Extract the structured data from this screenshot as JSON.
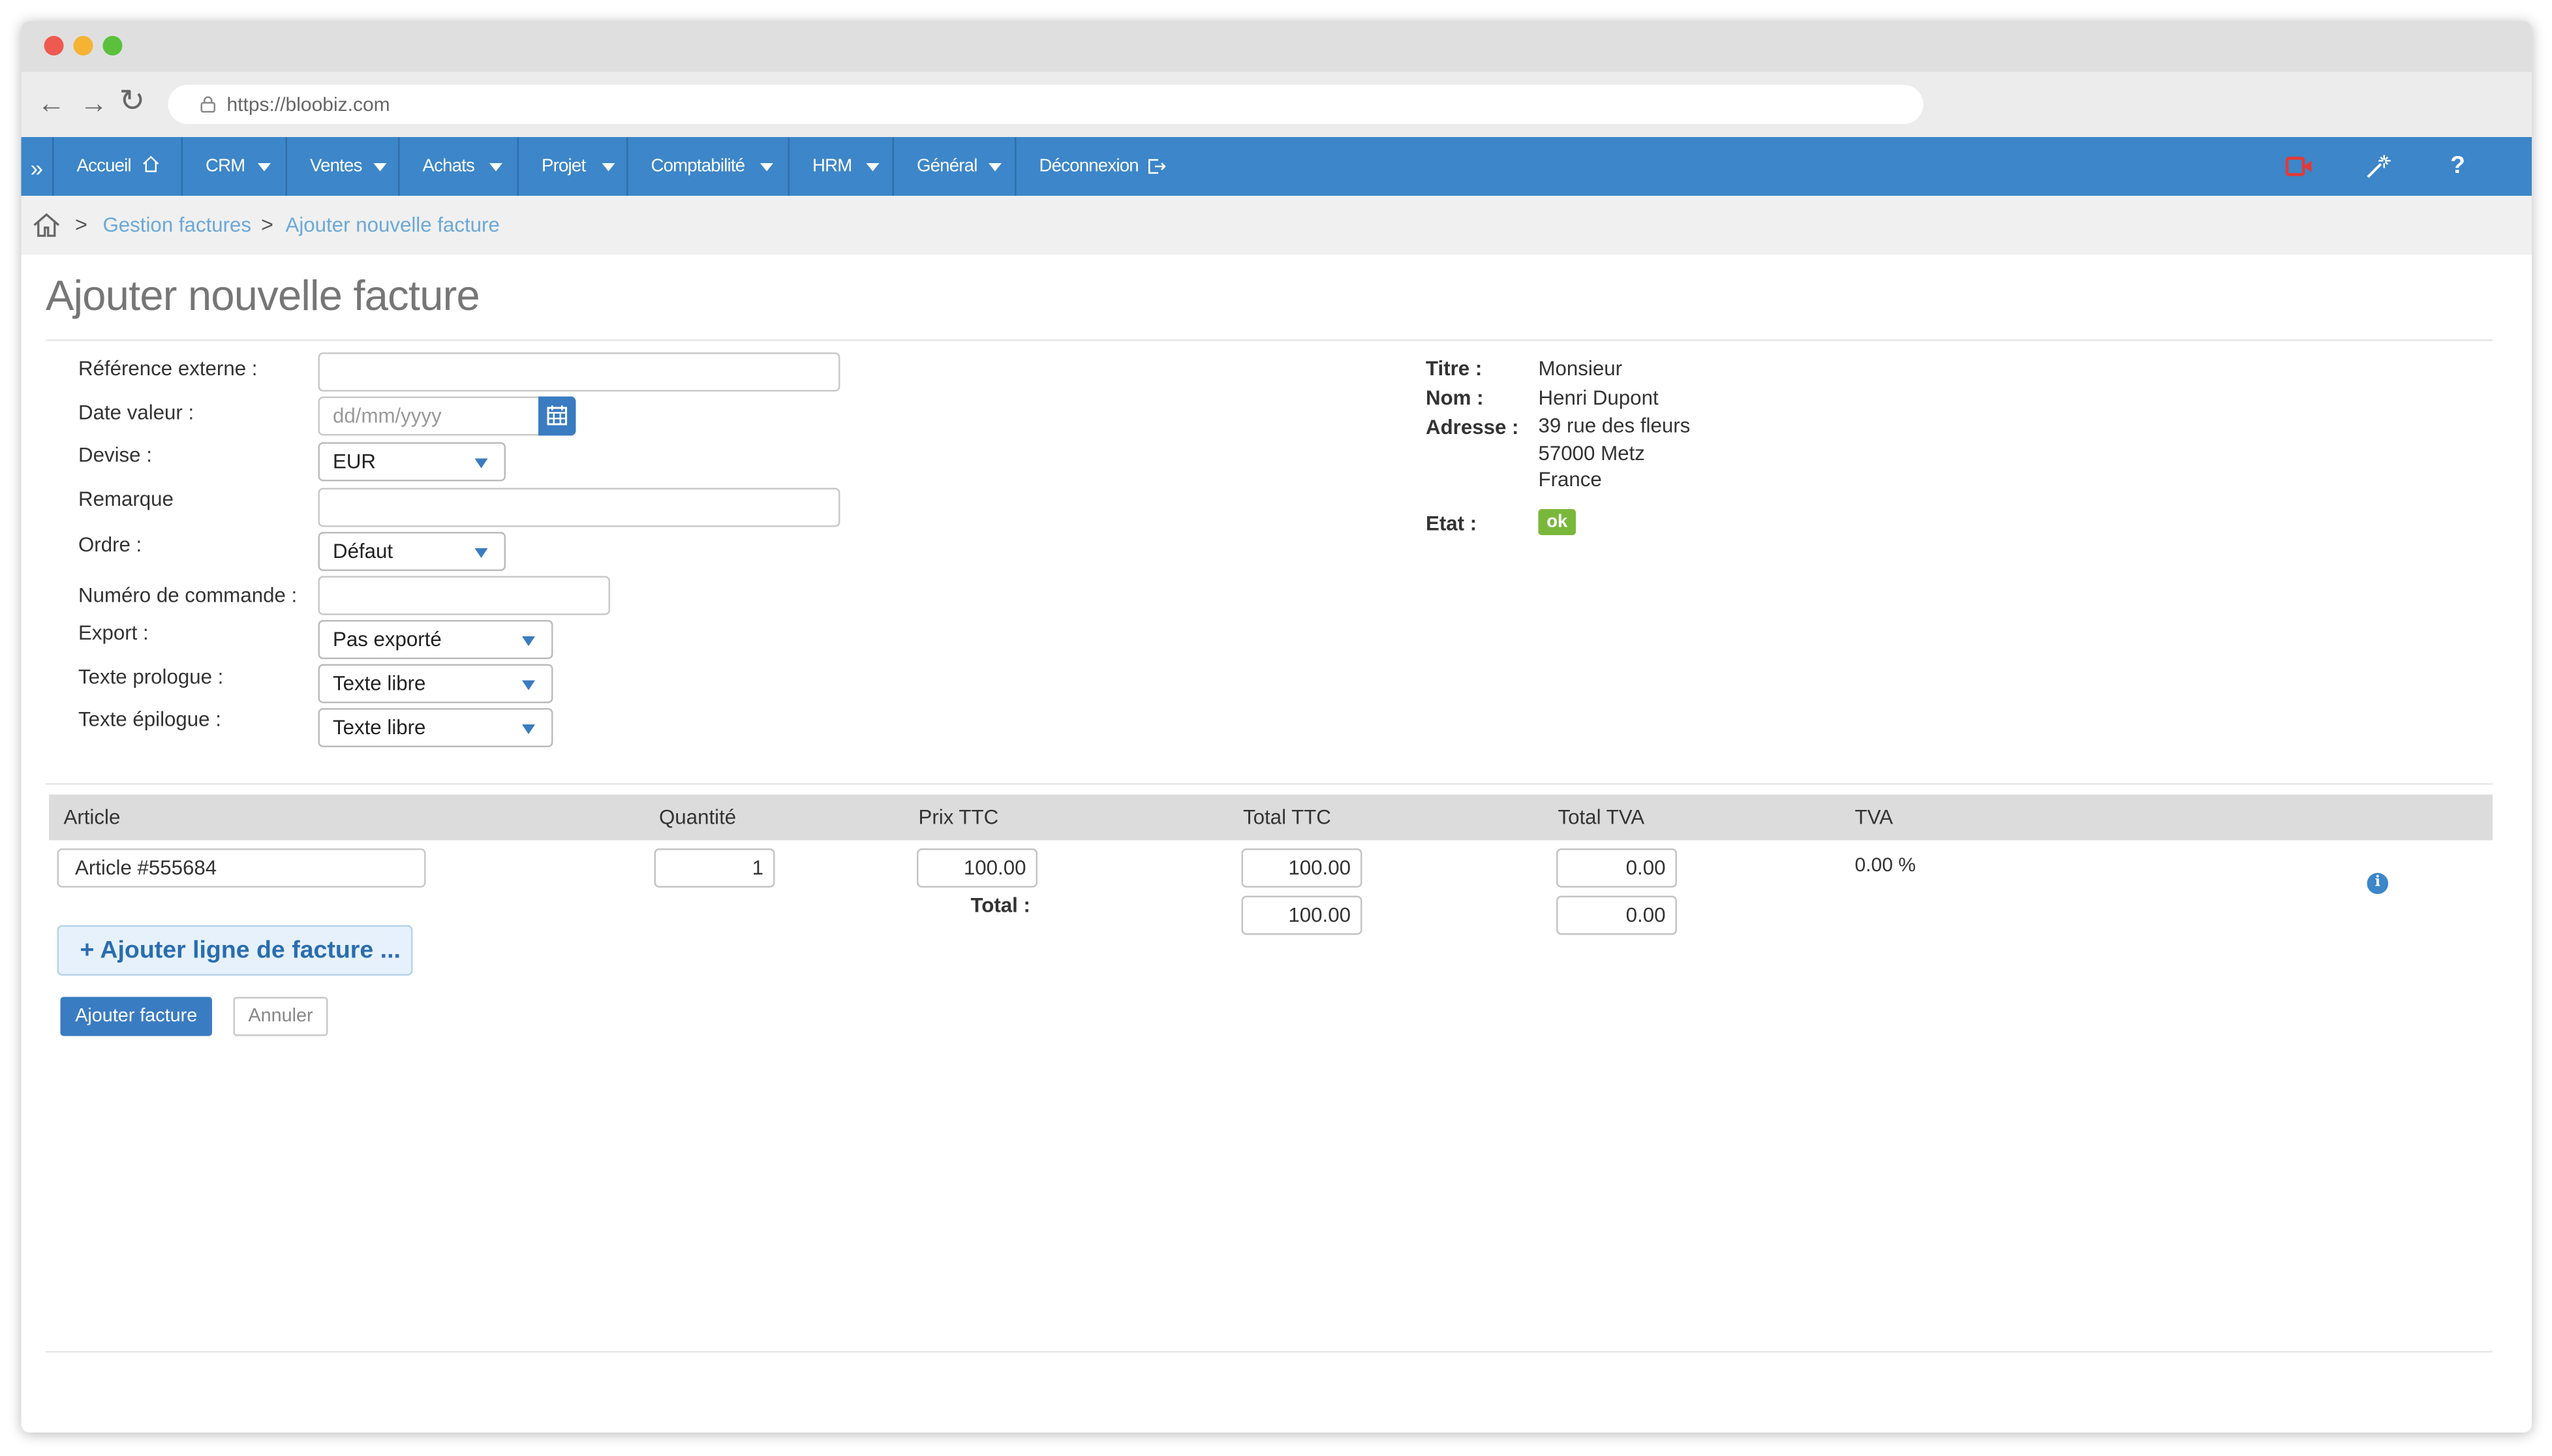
{
  "browser": {
    "url": "https://bloobiz.com",
    "back": "←",
    "forward": "→",
    "reload": "↻"
  },
  "menu": {
    "toggle": "»",
    "items": [
      {
        "label": "Accueil"
      },
      {
        "label": "CRM"
      },
      {
        "label": "Ventes"
      },
      {
        "label": "Achats"
      },
      {
        "label": "Projet"
      },
      {
        "label": "Comptabilité"
      },
      {
        "label": "HRM"
      },
      {
        "label": "Général"
      },
      {
        "label": "Déconnexion"
      }
    ],
    "help": "?"
  },
  "breadcrumb": {
    "sep": ">",
    "items": [
      "Gestion factures",
      "Ajouter nouvelle facture"
    ]
  },
  "page": {
    "title": "Ajouter nouvelle facture"
  },
  "form": {
    "reference_label": "Référence externe :",
    "reference_value": "",
    "date_label": "Date valeur :",
    "date_placeholder": "dd/mm/yyyy",
    "devise_label": "Devise :",
    "devise_value": "EUR",
    "remarque_label": "Remarque",
    "remarque_value": "",
    "ordre_label": "Ordre :",
    "ordre_value": "Défaut",
    "commande_label": "Numéro de commande :",
    "commande_value": "",
    "export_label": "Export :",
    "export_value": "Pas exporté",
    "prologue_label": "Texte prologue :",
    "prologue_value": "Texte libre",
    "epilogue_label": "Texte épilogue :",
    "epilogue_value": "Texte libre"
  },
  "customer": {
    "titre_label": "Titre :",
    "titre_value": "Monsieur",
    "nom_label": "Nom :",
    "nom_value": "Henri Dupont",
    "adresse_label": "Adresse :",
    "adresse_lines": [
      "39 rue des fleurs",
      "57000 Metz",
      "France"
    ],
    "etat_label": "Etat :",
    "etat_value": "ok",
    "etat_color": "#7ab83c"
  },
  "table": {
    "headers": [
      "Article",
      "Quantité",
      "Prix TTC",
      "Total TTC",
      "Total TVA",
      "TVA"
    ],
    "rows": [
      {
        "article": "Article #555684",
        "quantite": "1",
        "prix_ttc": "100.00",
        "total_ttc": "100.00",
        "total_tva": "0.00",
        "tva": "0.00 %"
      }
    ],
    "total_label": "Total :",
    "total_ttc": "100.00",
    "total_tva": "0.00",
    "info_icon": "i"
  },
  "actions": {
    "add_line": "+ Ajouter ligne de facture ...",
    "submit": "Ajouter facture",
    "cancel": "Annuler"
  },
  "colors": {
    "menu_bar": "#3c86c9",
    "primary": "#3a7cc1",
    "link": "#6aa8d8",
    "video_icon": "#e53935"
  }
}
